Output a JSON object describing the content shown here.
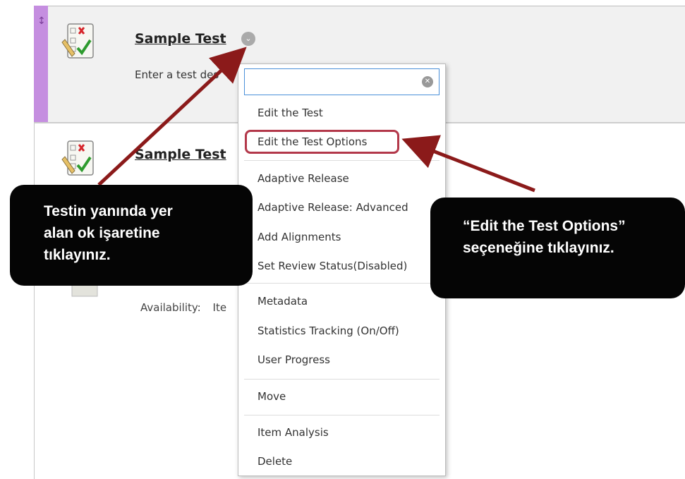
{
  "items": [
    {
      "title": "Sample Test",
      "description": "Enter a test des",
      "selected": true
    },
    {
      "title": "Sample Test",
      "availability_label": "Availability:",
      "availability_value": "Ite"
    }
  ],
  "context_menu": {
    "search_value": "",
    "items": [
      "Edit the Test",
      "Edit the Test Options",
      "Adaptive Release",
      "Adaptive Release: Advanced",
      "Add Alignments",
      "Set Review Status(Disabled)",
      "Metadata",
      "Statistics Tracking (On/Off)",
      "User Progress",
      "Move",
      "Item Analysis",
      "Delete"
    ],
    "highlighted_item": "Edit the Test Options"
  },
  "callouts": {
    "left": [
      "Testin yanında yer",
      "alan ok işaretine",
      "tıklayınız."
    ],
    "right": [
      "“Edit the Test Options”",
      "seçeneğine tıklayınız."
    ]
  },
  "colors": {
    "drag_bar": "#c58ee0",
    "arrow": "#8b1a1a",
    "highlight_border": "#b3384a",
    "callout_bg": "#050505"
  }
}
